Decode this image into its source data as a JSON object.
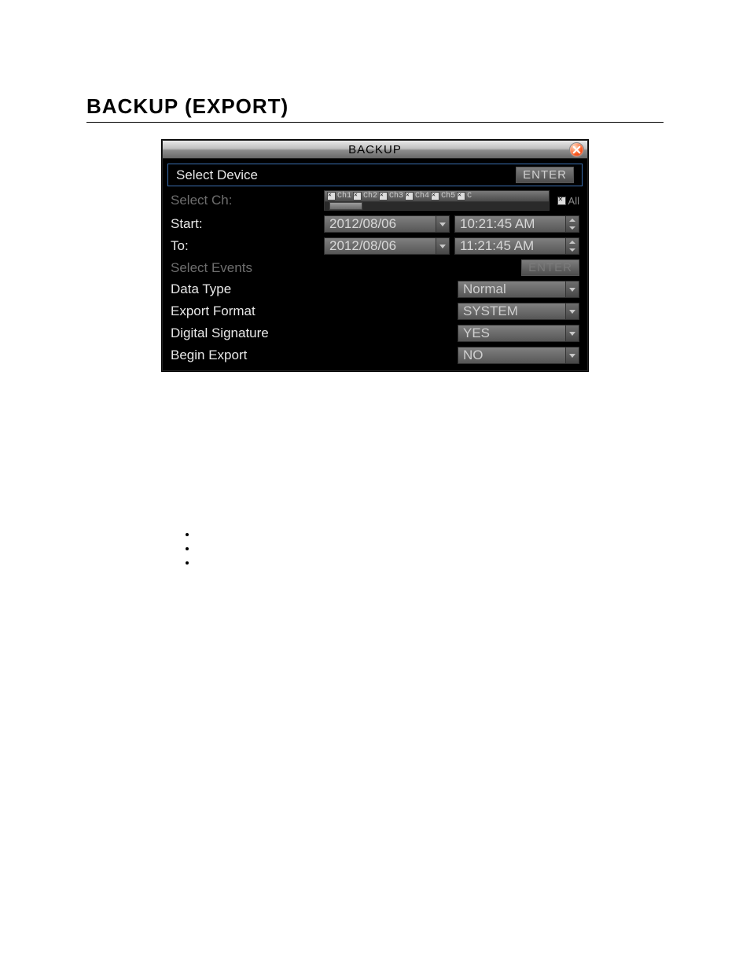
{
  "page": {
    "heading": "BACKUP (EXPORT)"
  },
  "dialog": {
    "title": "BACKUP",
    "rows": {
      "select_device": {
        "label": "Select Device",
        "button": "ENTER"
      },
      "select_ch": {
        "label": "Select Ch:",
        "channels": [
          "Ch1",
          "Ch2",
          "Ch3",
          "Ch4",
          "Ch5",
          "C"
        ],
        "all_label": "All"
      },
      "start": {
        "label": "Start:",
        "date": "2012/08/06",
        "time": "10:21:45 AM"
      },
      "to": {
        "label": "To:",
        "date": "2012/08/06",
        "time": "11:21:45 AM"
      },
      "select_events": {
        "label": "Select Events",
        "button": "ENTER"
      },
      "data_type": {
        "label": "Data Type",
        "value": "Normal"
      },
      "export_format": {
        "label": "Export Format",
        "value": "SYSTEM"
      },
      "digital_signature": {
        "label": "Digital Signature",
        "value": "YES"
      },
      "begin_export": {
        "label": "Begin Export",
        "value": "NO"
      }
    }
  }
}
